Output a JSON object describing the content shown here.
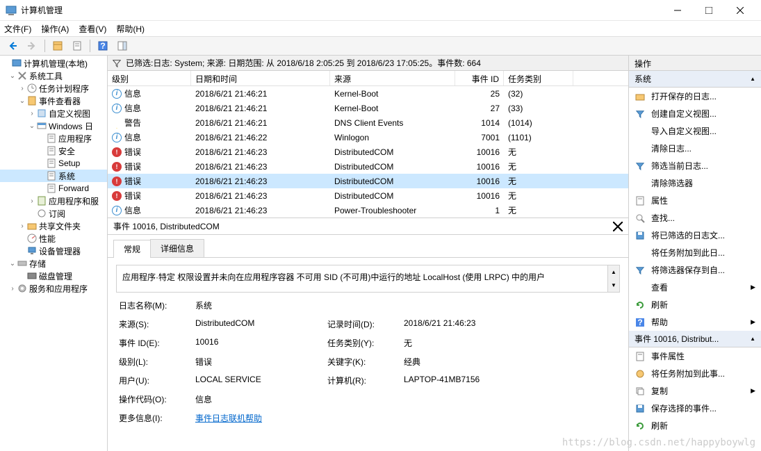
{
  "window": {
    "title": "计算机管理"
  },
  "menu": [
    "文件(F)",
    "操作(A)",
    "查看(V)",
    "帮助(H)"
  ],
  "tree": [
    {
      "lvl": 1,
      "exp": "",
      "icon": "mmc",
      "label": "计算机管理(本地)"
    },
    {
      "lvl": 2,
      "exp": "v",
      "icon": "tools",
      "label": "系统工具"
    },
    {
      "lvl": 3,
      "exp": ">",
      "icon": "sched",
      "label": "任务计划程序"
    },
    {
      "lvl": 3,
      "exp": "v",
      "icon": "event",
      "label": "事件查看器"
    },
    {
      "lvl": 4,
      "exp": ">",
      "icon": "custom",
      "label": "自定义视图"
    },
    {
      "lvl": 4,
      "exp": "v",
      "icon": "winlog",
      "label": "Windows 日"
    },
    {
      "lvl": 5,
      "exp": "",
      "icon": "log",
      "label": "应用程序"
    },
    {
      "lvl": 5,
      "exp": "",
      "icon": "log",
      "label": "安全"
    },
    {
      "lvl": 5,
      "exp": "",
      "icon": "log",
      "label": "Setup"
    },
    {
      "lvl": 5,
      "exp": "",
      "icon": "log",
      "label": "系统",
      "sel": true
    },
    {
      "lvl": 5,
      "exp": "",
      "icon": "log",
      "label": "Forward"
    },
    {
      "lvl": 4,
      "exp": ">",
      "icon": "applog",
      "label": "应用程序和服"
    },
    {
      "lvl": 4,
      "exp": "",
      "icon": "sub",
      "label": "订阅"
    },
    {
      "lvl": 3,
      "exp": ">",
      "icon": "share",
      "label": "共享文件夹"
    },
    {
      "lvl": 3,
      "exp": "",
      "icon": "perf",
      "label": "性能"
    },
    {
      "lvl": 3,
      "exp": "",
      "icon": "devmgr",
      "label": "设备管理器"
    },
    {
      "lvl": 2,
      "exp": "v",
      "icon": "storage",
      "label": "存储"
    },
    {
      "lvl": 3,
      "exp": "",
      "icon": "disk",
      "label": "磁盘管理"
    },
    {
      "lvl": 2,
      "exp": ">",
      "icon": "svc",
      "label": "服务和应用程序"
    }
  ],
  "filter": {
    "text": "已筛选:日志: System; 来源: 日期范围: 从 2018/6/18 2:05:25 到 2018/6/23 17:05:25。事件数: 664"
  },
  "gridHeaders": {
    "level": "级别",
    "date": "日期和时间",
    "src": "来源",
    "id": "事件 ID",
    "cat": "任务类别"
  },
  "rows": [
    {
      "icon": "info",
      "level": "信息",
      "date": "2018/6/21 21:46:21",
      "src": "Kernel-Boot",
      "id": "25",
      "cat": "(32)"
    },
    {
      "icon": "info",
      "level": "信息",
      "date": "2018/6/21 21:46:21",
      "src": "Kernel-Boot",
      "id": "27",
      "cat": "(33)"
    },
    {
      "icon": "warn",
      "level": "警告",
      "date": "2018/6/21 21:46:21",
      "src": "DNS Client Events",
      "id": "1014",
      "cat": "(1014)"
    },
    {
      "icon": "info",
      "level": "信息",
      "date": "2018/6/21 21:46:22",
      "src": "Winlogon",
      "id": "7001",
      "cat": "(1101)"
    },
    {
      "icon": "err",
      "level": "错误",
      "date": "2018/6/21 21:46:23",
      "src": "DistributedCOM",
      "id": "10016",
      "cat": "无"
    },
    {
      "icon": "err",
      "level": "错误",
      "date": "2018/6/21 21:46:23",
      "src": "DistributedCOM",
      "id": "10016",
      "cat": "无"
    },
    {
      "icon": "err",
      "level": "错误",
      "date": "2018/6/21 21:46:23",
      "src": "DistributedCOM",
      "id": "10016",
      "cat": "无",
      "sel": true
    },
    {
      "icon": "err",
      "level": "错误",
      "date": "2018/6/21 21:46:23",
      "src": "DistributedCOM",
      "id": "10016",
      "cat": "无"
    },
    {
      "icon": "info",
      "level": "信息",
      "date": "2018/6/21 21:46:23",
      "src": "Power-Troubleshooter",
      "id": "1",
      "cat": "无"
    }
  ],
  "detail": {
    "title": "事件 10016, DistributedCOM",
    "tabs": {
      "general": "常规",
      "details": "详细信息"
    },
    "desc": "应用程序·特定 权限设置并未向在应用程序容器 不可用 SID (不可用)中运行的地址 LocalHost (使用 LRPC) 中的用户",
    "labels": {
      "logName": "日志名称(M):",
      "source": "来源(S):",
      "recorded": "记录时间(D):",
      "eventId": "事件 ID(E):",
      "taskCat": "任务类别(Y):",
      "level": "级别(L):",
      "keywords": "关键字(K):",
      "user": "用户(U):",
      "computer": "计算机(R):",
      "opcode": "操作代码(O):",
      "moreInfo": "更多信息(I):"
    },
    "values": {
      "logName": "系统",
      "source": "DistributedCOM",
      "recorded": "2018/6/21 21:46:23",
      "eventId": "10016",
      "taskCat": "无",
      "level": "错误",
      "keywords": "经典",
      "user": "LOCAL SERVICE",
      "computer": "LAPTOP-41MB7156",
      "opcode": "信息",
      "moreInfo": "事件日志联机帮助"
    }
  },
  "actions": {
    "title": "操作",
    "section1": "系统",
    "items1": [
      {
        "icon": "open",
        "label": "打开保存的日志..."
      },
      {
        "icon": "filter",
        "label": "创建自定义视图..."
      },
      {
        "icon": "",
        "label": "导入自定义视图..."
      },
      {
        "icon": "",
        "label": "清除日志..."
      },
      {
        "icon": "filter",
        "label": "筛选当前日志..."
      },
      {
        "icon": "",
        "label": "清除筛选器"
      },
      {
        "icon": "props",
        "label": "属性"
      },
      {
        "icon": "find",
        "label": "查找..."
      },
      {
        "icon": "save",
        "label": "将已筛选的日志文..."
      },
      {
        "icon": "",
        "label": "将任务附加到此日..."
      },
      {
        "icon": "filter",
        "label": "将筛选器保存到自..."
      },
      {
        "icon": "",
        "label": "查看",
        "arrow": true
      },
      {
        "icon": "refresh",
        "label": "刷新"
      },
      {
        "icon": "help",
        "label": "帮助",
        "arrow": true
      }
    ],
    "section2": "事件 10016, Distribut...",
    "items2": [
      {
        "icon": "props",
        "label": "事件属性"
      },
      {
        "icon": "attach",
        "label": "将任务附加到此事..."
      },
      {
        "icon": "copy",
        "label": "复制",
        "arrow": true
      },
      {
        "icon": "save",
        "label": "保存选择的事件..."
      },
      {
        "icon": "refresh",
        "label": "刷新"
      }
    ]
  },
  "watermark": "https://blog.csdn.net/happyboywlg"
}
